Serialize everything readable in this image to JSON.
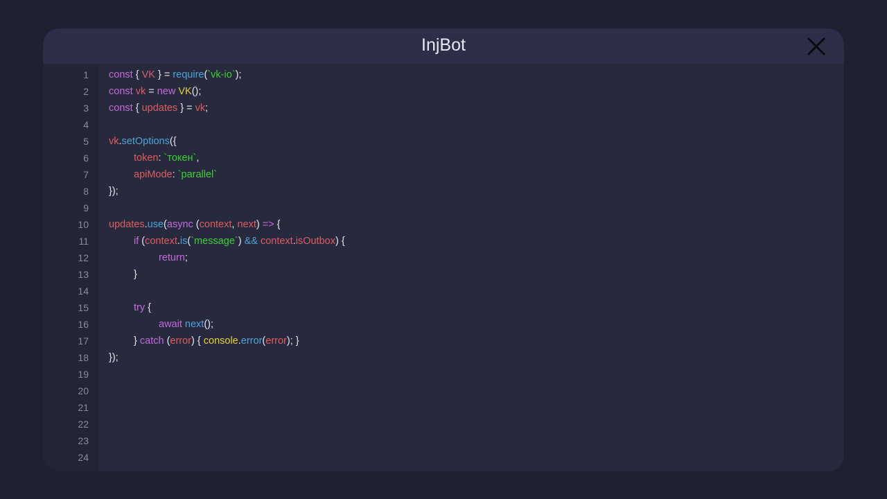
{
  "window": {
    "title": "InjBot",
    "close_icon": "close-x-icon"
  },
  "colors": {
    "p": "#c36bdc",
    "r": "#de5c62",
    "b": "#4da3db",
    "g": "#3fcf3a",
    "y": "#e8d03a",
    "w": "#e6e6ee"
  },
  "code": {
    "line_numbers": [
      "1",
      "2",
      "3",
      "4",
      "5",
      "6",
      "7",
      "8",
      "9",
      "10",
      "11",
      "12",
      "13",
      "14",
      "15",
      "16",
      "17",
      "18",
      "19",
      "20",
      "21",
      "22",
      "23",
      "24"
    ],
    "lines": [
      {
        "indent": 0,
        "tokens": [
          {
            "t": "const",
            "c": "p"
          },
          {
            "t": " { ",
            "c": "w"
          },
          {
            "t": "VK",
            "c": "r"
          },
          {
            "t": " } = ",
            "c": "w"
          },
          {
            "t": "require",
            "c": "b"
          },
          {
            "t": "(",
            "c": "w"
          },
          {
            "t": "`vk-io`",
            "c": "g"
          },
          {
            "t": ");",
            "c": "w"
          }
        ]
      },
      {
        "indent": 0,
        "tokens": [
          {
            "t": "const",
            "c": "p"
          },
          {
            "t": " ",
            "c": "w"
          },
          {
            "t": "vk",
            "c": "r"
          },
          {
            "t": " = ",
            "c": "w"
          },
          {
            "t": "new",
            "c": "p"
          },
          {
            "t": " ",
            "c": "w"
          },
          {
            "t": "VK",
            "c": "y"
          },
          {
            "t": "();",
            "c": "w"
          }
        ]
      },
      {
        "indent": 0,
        "tokens": [
          {
            "t": "const",
            "c": "p"
          },
          {
            "t": " { ",
            "c": "w"
          },
          {
            "t": "updates",
            "c": "r"
          },
          {
            "t": " } = ",
            "c": "w"
          },
          {
            "t": "vk",
            "c": "r"
          },
          {
            "t": ";",
            "c": "w"
          }
        ]
      },
      {
        "indent": 0,
        "tokens": []
      },
      {
        "indent": 0,
        "tokens": [
          {
            "t": "vk",
            "c": "r"
          },
          {
            "t": ".",
            "c": "w"
          },
          {
            "t": "setOptions",
            "c": "b"
          },
          {
            "t": "({",
            "c": "w"
          }
        ]
      },
      {
        "indent": 1,
        "tokens": [
          {
            "t": "token",
            "c": "r"
          },
          {
            "t": ": ",
            "c": "w"
          },
          {
            "t": "`токен`",
            "c": "g"
          },
          {
            "t": ",",
            "c": "w"
          }
        ]
      },
      {
        "indent": 1,
        "tokens": [
          {
            "t": "apiMode",
            "c": "r"
          },
          {
            "t": ": ",
            "c": "w"
          },
          {
            "t": "`parallel`",
            "c": "g"
          }
        ]
      },
      {
        "indent": 0,
        "tokens": [
          {
            "t": "});",
            "c": "w"
          }
        ]
      },
      {
        "indent": 0,
        "tokens": []
      },
      {
        "indent": 0,
        "tokens": [
          {
            "t": "updates",
            "c": "r"
          },
          {
            "t": ".",
            "c": "w"
          },
          {
            "t": "use",
            "c": "b"
          },
          {
            "t": "(",
            "c": "w"
          },
          {
            "t": "async",
            "c": "p"
          },
          {
            "t": " (",
            "c": "w"
          },
          {
            "t": "context",
            "c": "r"
          },
          {
            "t": ", ",
            "c": "w"
          },
          {
            "t": "next",
            "c": "r"
          },
          {
            "t": ") ",
            "c": "w"
          },
          {
            "t": "=>",
            "c": "p"
          },
          {
            "t": " {",
            "c": "w"
          }
        ]
      },
      {
        "indent": 1,
        "tokens": [
          {
            "t": "if",
            "c": "p"
          },
          {
            "t": " (",
            "c": "w"
          },
          {
            "t": "context",
            "c": "r"
          },
          {
            "t": ".",
            "c": "w"
          },
          {
            "t": "is",
            "c": "b"
          },
          {
            "t": "(",
            "c": "w"
          },
          {
            "t": "`message`",
            "c": "g"
          },
          {
            "t": ") ",
            "c": "w"
          },
          {
            "t": "&&",
            "c": "b"
          },
          {
            "t": " ",
            "c": "w"
          },
          {
            "t": "context",
            "c": "r"
          },
          {
            "t": ".",
            "c": "w"
          },
          {
            "t": "isOutbox",
            "c": "r"
          },
          {
            "t": ") {",
            "c": "w"
          }
        ]
      },
      {
        "indent": 2,
        "tokens": [
          {
            "t": "return",
            "c": "p"
          },
          {
            "t": ";",
            "c": "w"
          }
        ]
      },
      {
        "indent": 1,
        "tokens": [
          {
            "t": "}",
            "c": "w"
          }
        ]
      },
      {
        "indent": 0,
        "tokens": []
      },
      {
        "indent": 1,
        "tokens": [
          {
            "t": "try",
            "c": "p"
          },
          {
            "t": " {",
            "c": "w"
          }
        ]
      },
      {
        "indent": 2,
        "tokens": [
          {
            "t": "await",
            "c": "p"
          },
          {
            "t": " ",
            "c": "w"
          },
          {
            "t": "next",
            "c": "b"
          },
          {
            "t": "();",
            "c": "w"
          }
        ]
      },
      {
        "indent": 1,
        "tokens": [
          {
            "t": "} ",
            "c": "w"
          },
          {
            "t": "catch",
            "c": "p"
          },
          {
            "t": " (",
            "c": "w"
          },
          {
            "t": "error",
            "c": "r"
          },
          {
            "t": ") { ",
            "c": "w"
          },
          {
            "t": "console",
            "c": "y"
          },
          {
            "t": ".",
            "c": "w"
          },
          {
            "t": "error",
            "c": "b"
          },
          {
            "t": "(",
            "c": "w"
          },
          {
            "t": "error",
            "c": "r"
          },
          {
            "t": "); }",
            "c": "w"
          }
        ]
      },
      {
        "indent": 0,
        "tokens": [
          {
            "t": "});",
            "c": "w"
          }
        ]
      }
    ]
  }
}
